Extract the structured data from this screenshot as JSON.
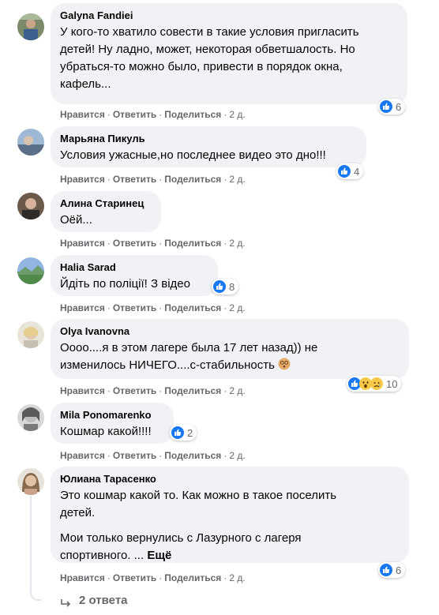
{
  "actions": {
    "like": "Нравится",
    "reply": "Ответить",
    "share": "Поделиться",
    "dot": "·"
  },
  "comments": [
    {
      "author": "Galyna Fandiei",
      "lines": [
        "У кого-то хватило совести в такие условия пригласить",
        "детей! Ну ладно, может, некоторая обветшалость. Но",
        "убраться-то можно было, привести в порядок окна,",
        "кафель..."
      ],
      "time": "2 д.",
      "reactions": {
        "icons": [
          "like-icon"
        ],
        "count": "6"
      }
    },
    {
      "author": "Марьяна Пикуль",
      "lines": [
        "Условия ужасные,но последнее видео это дно!!!"
      ],
      "time": "2 д.",
      "reactions": {
        "icons": [
          "like-icon"
        ],
        "count": "4"
      }
    },
    {
      "author": "Алина Старинец",
      "lines": [
        "Оёй..."
      ],
      "time": "2 д."
    },
    {
      "author": "Halia Sarad",
      "lines": [
        "Йдіть по поліції! З відео"
      ],
      "time": "2 д.",
      "reactions": {
        "icons": [
          "like-icon"
        ],
        "count": "8"
      }
    },
    {
      "author": "Olya Ivanovna",
      "lines": [
        "Оооо....я в этом лагере была 17 лет назад)) не",
        "изменилось НИЧЕГО....с-стабильность"
      ],
      "emoji": "dizzy-face-emoji",
      "time": "2 д.",
      "reactions": {
        "icons": [
          "like-icon",
          "wow-icon",
          "sad-icon"
        ],
        "count": "10"
      }
    },
    {
      "author": "Mila Ponomarenko",
      "lines": [
        "Кошмар какой!!!!"
      ],
      "time": "2 д.",
      "reactions": {
        "icons": [
          "like-icon"
        ],
        "count": "2"
      }
    },
    {
      "author": "Юлиана Тарасенко",
      "paragraphs": [
        [
          "Это кошмар какой то. Как можно в такое поселить",
          "детей."
        ],
        [
          "Мои только вернулись с Лазурного с лагеря",
          "спортивного. ..."
        ]
      ],
      "more": "Ещё",
      "time": "2 д.",
      "reactions": {
        "icons": [
          "like-icon"
        ],
        "count": "6"
      }
    }
  ],
  "replies_label": "2 ответа",
  "colors": {
    "like_blue": "#1877f2",
    "bubble": "#f0f2f5",
    "meta": "#65676b"
  }
}
